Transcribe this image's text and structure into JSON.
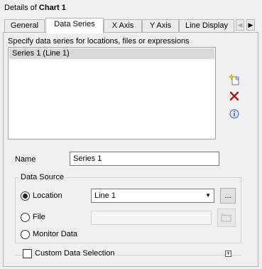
{
  "window": {
    "title_prefix": "Details of ",
    "title_bold": "Chart 1"
  },
  "tabs": [
    {
      "label": "General",
      "active": false
    },
    {
      "label": "Data Series",
      "active": true
    },
    {
      "label": "X Axis",
      "active": false
    },
    {
      "label": "Y Axis",
      "active": false
    },
    {
      "label": "Line Display",
      "active": false
    }
  ],
  "data_series": {
    "instruction": "Specify data series for locations, files or expressions",
    "items": [
      "Series 1 (Line 1)"
    ],
    "icons": {
      "add": "add-series-icon",
      "delete": "delete-series-icon",
      "info": "info-icon"
    }
  },
  "name_field": {
    "label": "Name",
    "value": "Series 1"
  },
  "data_source": {
    "title": "Data Source",
    "location_label": "Location",
    "location_value": "Line 1",
    "browse_label": "...",
    "file_label": "File",
    "file_value": "",
    "monitor_label": "Monitor Data",
    "selected": "location"
  },
  "custom_selection": {
    "label": "Custom Data Selection",
    "checked": false
  }
}
